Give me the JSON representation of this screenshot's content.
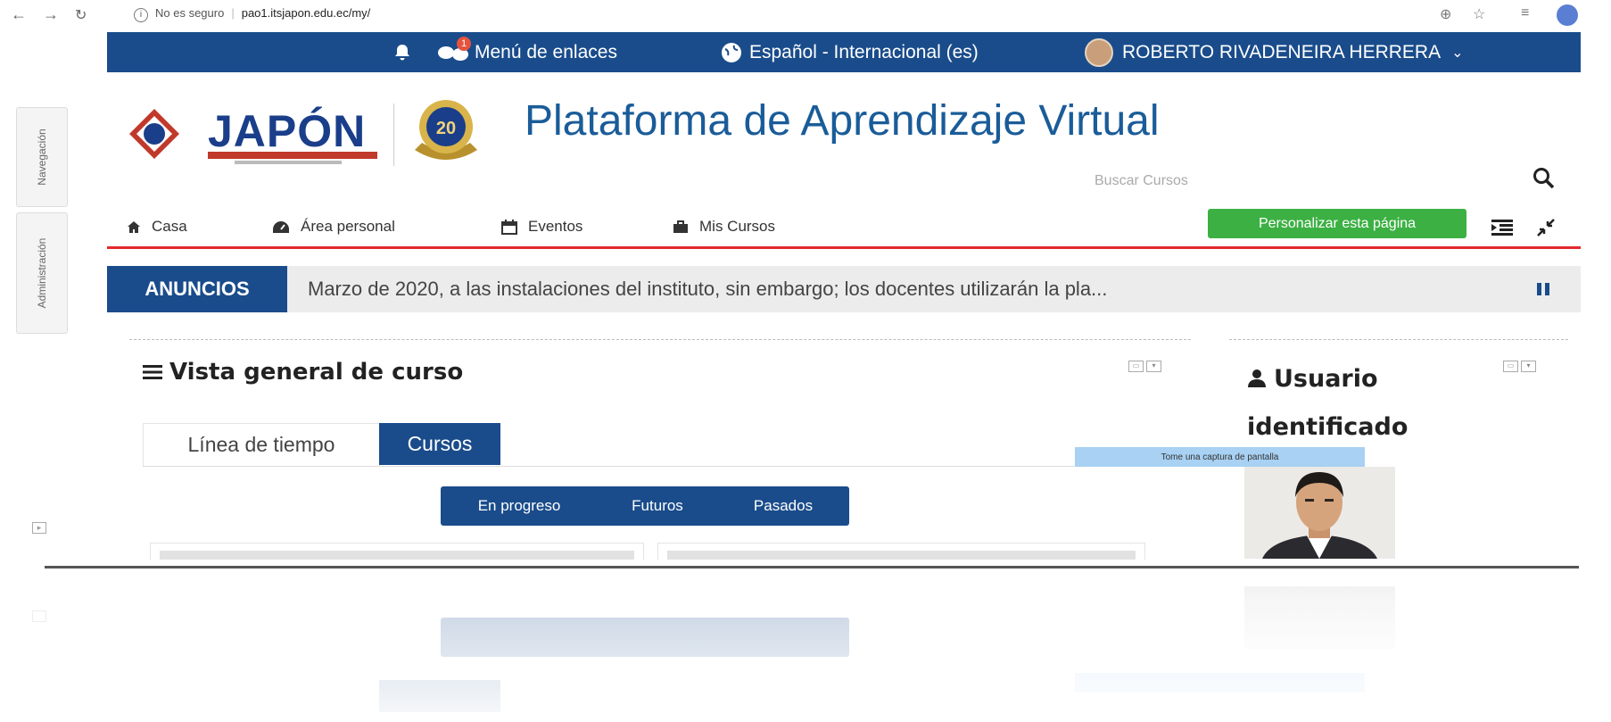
{
  "browser": {
    "security_label": "No es seguro",
    "url": "pao1.itsjapon.edu.ec/my/"
  },
  "topbar": {
    "notification_count": "1",
    "links_menu": "Menú de enlaces",
    "language": "Español - Internacional (es)",
    "user_name": "ROBERTO RIVADENEIRA HERRERA"
  },
  "drawer": {
    "navigation": "Navegación",
    "administration": "Administración"
  },
  "header": {
    "logo_text": "JAPÓN",
    "anniversary": "20",
    "site_title": "Plataforma de Aprendizaje Virtual",
    "search_placeholder": "Buscar Cursos"
  },
  "nav": {
    "items": [
      {
        "label": "Casa",
        "icon": "home-icon"
      },
      {
        "label": "Área personal",
        "icon": "dashboard-icon"
      },
      {
        "label": "Eventos",
        "icon": "calendar-icon"
      },
      {
        "label": "Mis Cursos",
        "icon": "briefcase-icon"
      }
    ],
    "customize_label": "Personalizar esta página"
  },
  "announcements": {
    "label": "ANUNCIOS",
    "text": "Marzo de 2020, a las instalaciones del instituto, sin embargo; los docentes utilizarán la pla..."
  },
  "course_overview": {
    "title": "Vista general de curso",
    "tabs": [
      "Línea de tiempo",
      "Cursos"
    ],
    "active_tab": "Cursos",
    "filters": [
      "En progreso",
      "Futuros",
      "Pasados"
    ]
  },
  "user_block": {
    "title": "Usuario identificado",
    "screenshot_tip": "Tome una captura de pantalla"
  },
  "colors": {
    "brand_blue": "#1a4c8b",
    "accent_red": "#e3282d",
    "button_green": "#3cb043",
    "title_blue": "#1a5c99"
  }
}
